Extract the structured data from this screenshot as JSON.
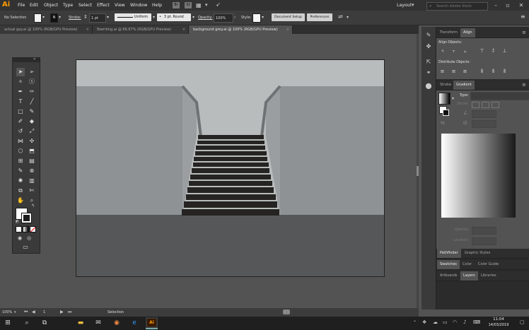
{
  "app": {
    "logo": "Ai"
  },
  "menu": {
    "items": [
      "File",
      "Edit",
      "Object",
      "Type",
      "Select",
      "Effect",
      "View",
      "Window",
      "Help"
    ]
  },
  "top_right": {
    "workspace": "Layout",
    "search_placeholder": "Search Adobe Stock"
  },
  "control": {
    "selection_label": "No Selection",
    "stroke_label": "Stroke:",
    "stroke_value": "1 pt",
    "profile_label": "Uniform",
    "brush_label": "3 pt. Round",
    "opacity_label": "Opacity:",
    "opacity_value": "100%",
    "style_label": "Style:",
    "doc_setup": "Document Setup",
    "preferences": "Preferences"
  },
  "tabs": [
    {
      "label": "actual gay.ai @ 100% (RGB/GPU Preview)"
    },
    {
      "label": "fbwriting.ai @ 66.67% (RGB/GPU Preview)"
    },
    {
      "label": "background grey.ai @ 100% (RGB/GPU Preview)"
    }
  ],
  "panels": {
    "transform_tab": "Transform",
    "align_tab": "Align",
    "align_objects": "Align Objects:",
    "distribute_objects": "Distribute Objects:",
    "stroke_tab": "Stroke",
    "gradient_tab": "Gradient",
    "type_label": "Type:",
    "stroke_row": "Stroke:",
    "opacity_row": "Opacity:",
    "location_row": "Location:",
    "pathfinder_tab": "Pathfinder",
    "graphic_styles_tab": "Graphic Styles",
    "swatches_tab": "Swatches",
    "color_tab": "Color",
    "color_guide_tab": "Color Guide",
    "artboards_tab": "Artboards",
    "layers_tab": "Layers",
    "libraries_tab": "Libraries"
  },
  "status": {
    "zoom": "100%",
    "artboard_num": "1",
    "tool": "Selection"
  },
  "taskbar": {
    "time": "11:04",
    "date": "14/03/2019"
  },
  "colors": {
    "accent": "#ff9a00",
    "sky": "#b9bcbd",
    "wall": "#8e9294",
    "floor": "#555758",
    "step": "#252422",
    "rail": "#6f7274"
  }
}
